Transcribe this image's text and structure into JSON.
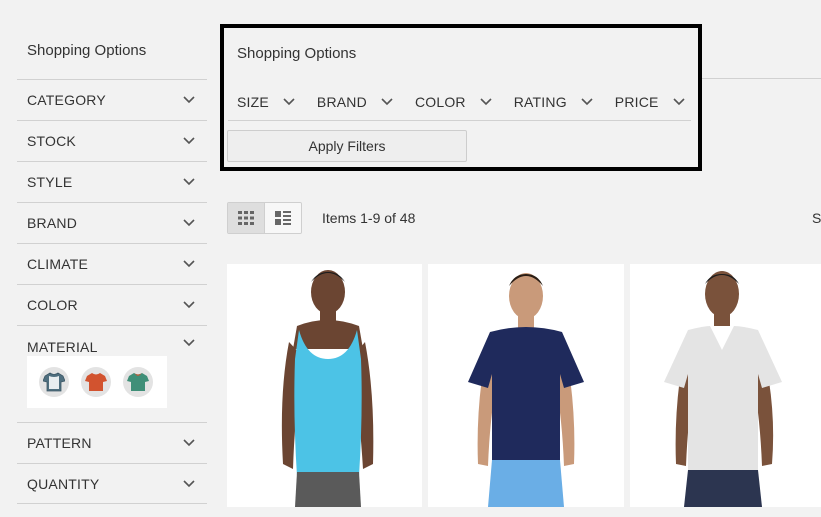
{
  "sidebar": {
    "title": "Shopping Options",
    "items": [
      {
        "label": "CATEGORY"
      },
      {
        "label": "STOCK"
      },
      {
        "label": "STYLE"
      },
      {
        "label": "BRAND"
      },
      {
        "label": "CLIMATE"
      },
      {
        "label": "COLOR"
      },
      {
        "label": "MATERIAL",
        "expanded": true,
        "swatches": [
          "shirt-blue-gray",
          "shirt-orange",
          "shirt-teal"
        ]
      },
      {
        "label": "PATTERN"
      },
      {
        "label": "QUANTITY"
      }
    ]
  },
  "panel": {
    "title": "Shopping Options",
    "filters": [
      {
        "label": "SIZE"
      },
      {
        "label": "BRAND"
      },
      {
        "label": "COLOR"
      },
      {
        "label": "RATING"
      },
      {
        "label": "PRICE"
      }
    ],
    "apply_label": "Apply Filters"
  },
  "toolbar": {
    "items_count": "Items 1-9 of 48",
    "sort_partial": "S",
    "view_modes": [
      "grid-icon",
      "list-icon"
    ],
    "active_view": "grid"
  },
  "products": [
    {
      "shirt_color": "#4cc3e6",
      "shorts_color": "#5a5a5a",
      "kind": "tank"
    },
    {
      "shirt_color": "#1f2a5c",
      "shorts_color": "#6aaee6",
      "kind": "tee"
    },
    {
      "shirt_color": "#e4e4e4",
      "shorts_color": "#2c3550",
      "kind": "vneck"
    }
  ],
  "colors": {
    "accent_border": "#000000",
    "page_bg": "#f2f2f2",
    "divider": "#d1d1d1"
  }
}
